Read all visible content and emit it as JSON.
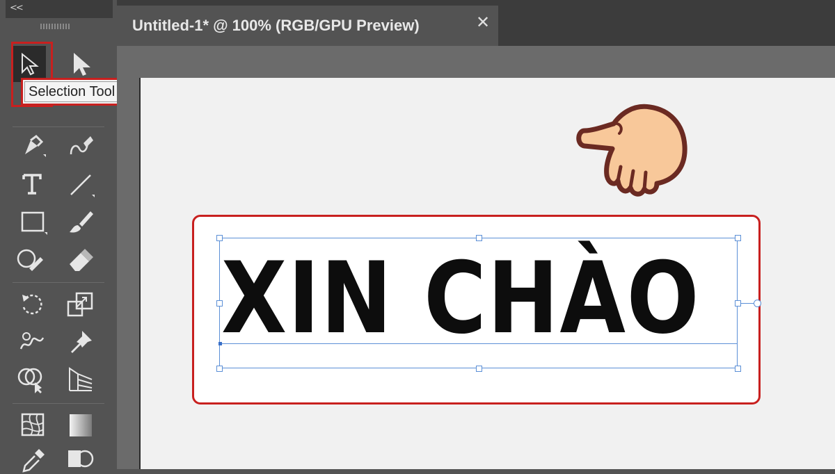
{
  "toolbar": {
    "collapse_glyph": "<<",
    "tooltip": "Selection Tool (V)",
    "tools": [
      {
        "name": "selection-tool",
        "icon": "arrow-icon"
      },
      {
        "name": "direct-selection-tool",
        "icon": "white-arrow-icon"
      },
      {
        "name": "pen-tool",
        "icon": "pen-icon"
      },
      {
        "name": "curvature-tool",
        "icon": "curvature-pen-icon"
      },
      {
        "name": "type-tool",
        "icon": "type-icon"
      },
      {
        "name": "line-tool",
        "icon": "line-icon"
      },
      {
        "name": "rectangle-tool",
        "icon": "rectangle-icon"
      },
      {
        "name": "paintbrush-tool",
        "icon": "brush-icon"
      },
      {
        "name": "shaper-tool",
        "icon": "shaper-icon"
      },
      {
        "name": "eraser-tool",
        "icon": "eraser-icon"
      },
      {
        "name": "rotate-tool",
        "icon": "rotate-icon"
      },
      {
        "name": "scale-tool",
        "icon": "scale-icon"
      },
      {
        "name": "warp-tool",
        "icon": "warp-icon"
      },
      {
        "name": "puppet-warp-tool",
        "icon": "pin-icon"
      },
      {
        "name": "shape-builder-tool",
        "icon": "shape-builder-icon"
      },
      {
        "name": "perspective-grid-tool",
        "icon": "perspective-grid-icon"
      },
      {
        "name": "mesh-tool",
        "icon": "mesh-icon"
      },
      {
        "name": "gradient-tool",
        "icon": "gradient-icon"
      },
      {
        "name": "eyedropper-tool",
        "icon": "eyedropper-icon"
      },
      {
        "name": "blend-tool",
        "icon": "blend-icon"
      }
    ]
  },
  "document": {
    "tab_title": "Untitled-1* @ 100% (RGB/GPU Preview)",
    "close_glyph": "✕"
  },
  "canvas": {
    "text": "XIN CHÀO"
  },
  "colors": {
    "highlight": "#c8201f",
    "selection": "#5b8fd6",
    "hand_fill": "#f8c89a",
    "hand_outline": "#6b2a22"
  }
}
